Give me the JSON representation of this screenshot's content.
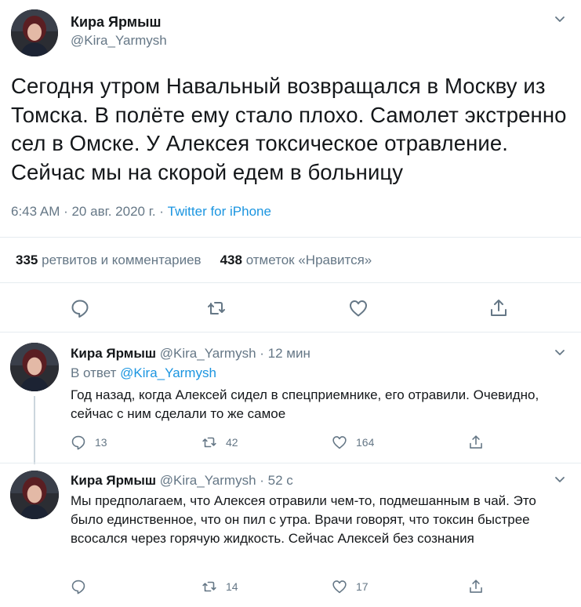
{
  "main_tweet": {
    "author_name": "Кира Ярмыш",
    "author_handle": "@Kira_Yarmysh",
    "text": "Сегодня утром Навальный возвращался в Москву из Томска. В полёте ему стало плохо. Самолет экстренно сел в Омске. У Алексея токсическое отравление. Сейчас мы на скорой едем в больницу",
    "time": "6:43 AM · 20 авг. 2020 г. · ",
    "source": "Twitter for iPhone",
    "retweets_count": "335",
    "retweets_label": "ретвитов и комментариев",
    "likes_count": "438",
    "likes_label": "отметок «Нравится»",
    "icons": [
      "chevron-down-icon",
      "reply-icon",
      "retweet-icon",
      "like-icon",
      "share-icon"
    ]
  },
  "replies": [
    {
      "author_name": "Кира Ярмыш",
      "author_handle": "@Kira_Yarmysh",
      "time": " · 12 мин",
      "reply_to_label": "В ответ ",
      "reply_to_handle": "@Kira_Yarmysh",
      "text": "Год назад, когда Алексей сидел в спецприемнике, его отравили. Очевидно, сейчас с ним сделали то же самое",
      "reply_count": "13",
      "retweet_count": "42",
      "like_count": "164"
    },
    {
      "author_name": "Кира Ярмыш",
      "author_handle": "@Kira_Yarmysh",
      "time": " · 52 с",
      "text": "Мы предполагаем, что Алексея отравили чем-то, подмешанным в чай. Это было единственное, что он пил с утра. Врачи говорят, что токсин быстрее всосался через горячую жидкость. Сейчас Алексей без сознания",
      "reply_count": "",
      "retweet_count": "14",
      "like_count": "17"
    }
  ],
  "colors": {
    "text_primary": "#14171a",
    "text_secondary": "#657786",
    "link": "#1b95e0",
    "divider": "#e6ecf0",
    "thread_line": "#ccd6dd"
  }
}
